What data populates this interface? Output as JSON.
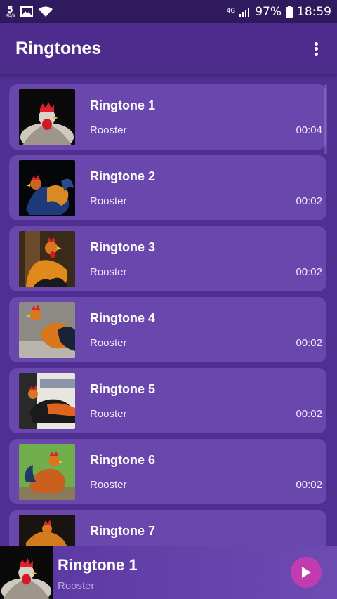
{
  "status": {
    "speed_num": "5",
    "speed_unit": "KB/s",
    "network": "4G",
    "battery": "97%",
    "time": "18:59"
  },
  "app": {
    "title": "Ringtones"
  },
  "ringtones": [
    {
      "title": "Ringtone 1",
      "subtitle": "Rooster",
      "duration": "00:04"
    },
    {
      "title": "Ringtone 2",
      "subtitle": "Rooster",
      "duration": "00:02"
    },
    {
      "title": "Ringtone 3",
      "subtitle": "Rooster",
      "duration": "00:02"
    },
    {
      "title": "Ringtone 4",
      "subtitle": "Rooster",
      "duration": "00:02"
    },
    {
      "title": "Ringtone 5",
      "subtitle": "Rooster",
      "duration": "00:02"
    },
    {
      "title": "Ringtone 6",
      "subtitle": "Rooster",
      "duration": "00:02"
    },
    {
      "title": "Ringtone 7"
    }
  ],
  "player": {
    "title": "Ringtone 1",
    "subtitle": "Rooster"
  },
  "icons": {
    "overflow": "more-vert-icon",
    "play": "play-icon",
    "image": "image-icon",
    "wifi": "wifi-icon",
    "signal": "signal-icon",
    "battery": "battery-icon"
  },
  "colors": {
    "background": "#4f2f92",
    "card": "#6a47ad",
    "statusbar": "#2e1a5c",
    "accent": "#c23bb0"
  }
}
